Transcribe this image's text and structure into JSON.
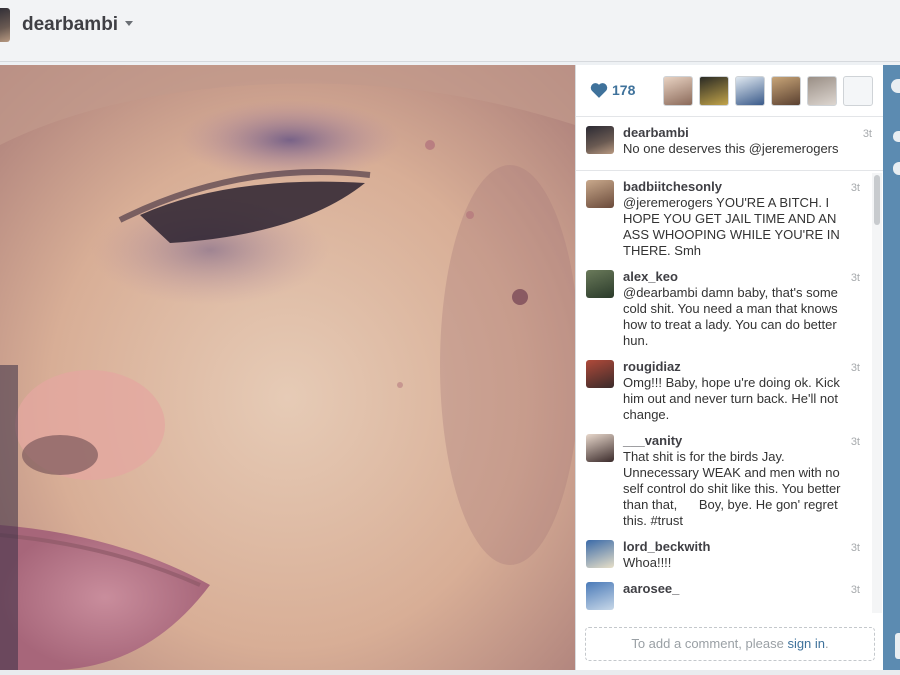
{
  "header": {
    "username": "dearbambi"
  },
  "likes": {
    "count": "178"
  },
  "caption": {
    "username": "dearbambi",
    "text": "No one deserves this @jeremerogers",
    "time": "3t"
  },
  "comments": [
    {
      "username": "badbiitchesonly",
      "text": "@jeremerogers YOU'RE A BITCH. I HOPE YOU GET JAIL TIME AND AN ASS WHOOPING WHILE YOU'RE IN THERE. Smh",
      "time": "3t"
    },
    {
      "username": "alex_keo",
      "text": "@dearbambi damn baby, that's some cold shit. You need a man that knows how to treat a lady. You can do better hun.",
      "time": "3t"
    },
    {
      "username": "rougidiaz",
      "text": "Omg!!! Baby, hope u're doing ok. Kick him out and never turn back. He'll not change.",
      "time": "3t"
    },
    {
      "username": "___vanity",
      "text": "That shit is for the birds Jay. Unnecessary WEAK and men with no self control do shit like this. You better than that,      Boy, bye. He gon' regret this. #trust",
      "time": "3t"
    },
    {
      "username": "lord_beckwith",
      "text": "Whoa!!!!",
      "time": "3t"
    },
    {
      "username": "aarosee_",
      "text": "",
      "time": "3t"
    }
  ],
  "add_comment": {
    "prefix": "To add a comment, please ",
    "link": "sign in",
    "suffix": "."
  },
  "icons": [
    "heart-icon",
    "chevron-down-icon"
  ],
  "colors": {
    "link": "#3f729b",
    "accent_edge": "#5c8bb1"
  }
}
